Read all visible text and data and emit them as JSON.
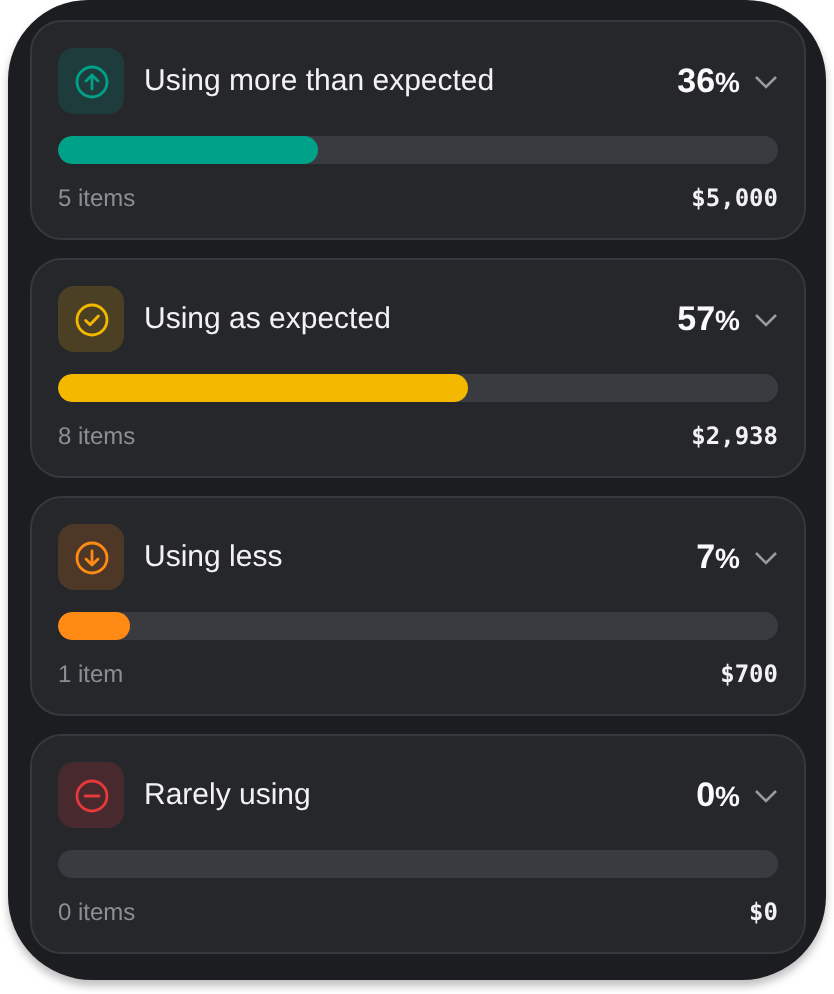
{
  "categories": [
    {
      "kind": "up",
      "title": "Using more than expected",
      "percent": "36",
      "percent_sign": "%",
      "level": 0.36,
      "color": "#00a189",
      "count": "5 items",
      "amount": "$5,000"
    },
    {
      "kind": "check",
      "title": "Using as expected",
      "percent": "57",
      "percent_sign": "%",
      "level": 0.57,
      "color": "#f5b800",
      "count": "8 items",
      "amount": "$2,938"
    },
    {
      "kind": "down",
      "title": "Using less",
      "percent": "7",
      "percent_sign": "%",
      "level": 0.1,
      "color": "#ff8a14",
      "count": "1 item",
      "amount": "$700"
    },
    {
      "kind": "minus",
      "title": "Rarely using",
      "percent": "0",
      "percent_sign": "%",
      "level": 0,
      "color": "#e5393b",
      "count": "0 items",
      "amount": "$0"
    }
  ]
}
